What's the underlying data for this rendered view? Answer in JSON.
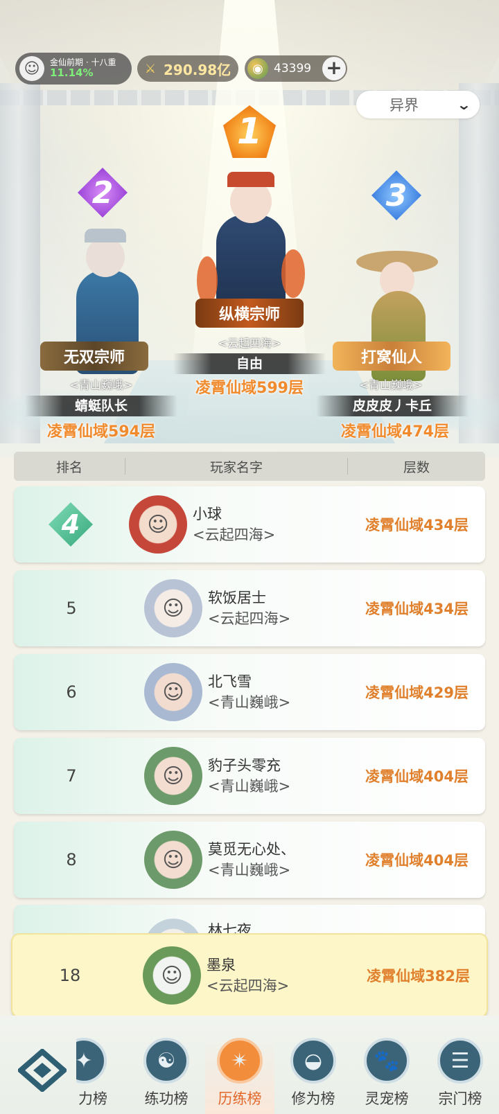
{
  "status_bar": {
    "realm_name": "金仙前期 · 十八重",
    "realm_progress": "11.14%",
    "currency_a": "290.98亿",
    "currency_b": "43399",
    "plus": "+"
  },
  "region_select": {
    "label": "异界",
    "chevron": "⌄"
  },
  "podium": {
    "first": {
      "rank": "1",
      "title": "纵横宗师",
      "guild": "<云起四海>",
      "name": "自由",
      "floor": "凌霄仙域599层"
    },
    "second": {
      "rank": "2",
      "title": "无双宗师",
      "guild": "<青山巍峨>",
      "name": "蜻蜓队长",
      "floor": "凌霄仙域594层"
    },
    "third": {
      "rank": "3",
      "title": "打窝仙人",
      "guild": "<青山巍峨>",
      "name": "皮皮皮丿卡丘",
      "floor": "凌霄仙域474层"
    }
  },
  "table": {
    "headers": [
      "排名",
      "玩家名字",
      "层数"
    ],
    "rows": [
      {
        "rank": "4",
        "name": "小球",
        "guild": "<云起四海>",
        "floor": "凌霄仙域434层"
      },
      {
        "rank": "5",
        "name": "软饭居士",
        "guild": "<云起四海>",
        "floor": "凌霄仙域434层"
      },
      {
        "rank": "6",
        "name": "北飞雪",
        "guild": "<青山巍峨>",
        "floor": "凌霄仙域429层"
      },
      {
        "rank": "7",
        "name": "豹子头零充",
        "guild": "<青山巍峨>",
        "floor": "凌霄仙域404层"
      },
      {
        "rank": "8",
        "name": "莫觅无心处、",
        "guild": "<青山巍峨>",
        "floor": "凌霄仙域404层"
      }
    ],
    "partial_row_name": "林七夜"
  },
  "self_row": {
    "rank": "18",
    "name": "墨泉",
    "guild": "<云起四海>",
    "floor": "凌霄仙域382层"
  },
  "bottom_nav": {
    "items": [
      {
        "label": "力榜",
        "icon": "sword-icon"
      },
      {
        "label": "练功榜",
        "icon": "yinyang-icon"
      },
      {
        "label": "历练榜",
        "icon": "shuriken-icon"
      },
      {
        "label": "修为榜",
        "icon": "hat-icon"
      },
      {
        "label": "灵宠榜",
        "icon": "cat-icon"
      },
      {
        "label": "宗门榜",
        "icon": "scroll-icon"
      }
    ],
    "active_index": 2
  },
  "colors": {
    "floor_text": "#e0802c",
    "active_nav": "#f28d3c",
    "rank1": "#f28a1e",
    "rank2": "#9b45d8",
    "rank3": "#3c7fe0"
  }
}
